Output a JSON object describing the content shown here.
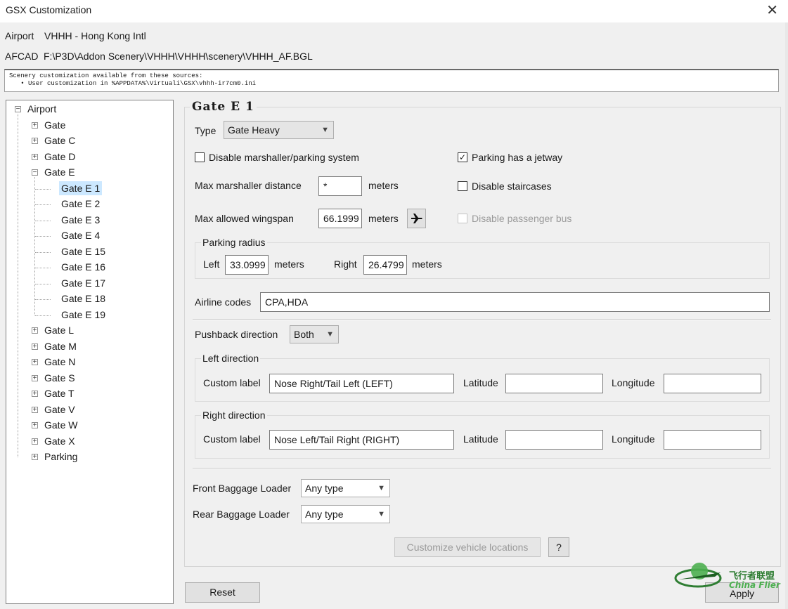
{
  "window": {
    "title": "GSX Customization",
    "close_glyph": "✕"
  },
  "header": {
    "airport_label": "Airport",
    "airport_value": "VHHH - Hong Kong Intl",
    "afcad_label": "AFCAD",
    "afcad_value": "F:\\P3D\\Addon Scenery\\VHHH\\VHHH\\scenery\\VHHH_AF.BGL"
  },
  "sources": {
    "line1": "Scenery customization available from these sources:",
    "line2": "   • User customization in %APPDATA%\\Virtuali\\GSX\\vhhh-ir7cm0.ini"
  },
  "tree": {
    "root": "Airport",
    "groups_before": [
      "Gate",
      "Gate C",
      "Gate D"
    ],
    "expanded_group": "Gate E",
    "children": [
      "Gate E 1",
      "Gate E 2",
      "Gate E 3",
      "Gate E 4",
      "Gate E 15",
      "Gate E 16",
      "Gate E 17",
      "Gate E 18",
      "Gate E 19"
    ],
    "groups_after": [
      "Gate L",
      "Gate M",
      "Gate N",
      "Gate S",
      "Gate T",
      "Gate V",
      "Gate W",
      "Gate X",
      "Parking"
    ],
    "selected": "Gate E 1"
  },
  "detail": {
    "title": "Gate E 1",
    "type_label": "Type",
    "type_value": "Gate Heavy",
    "disable_marshaller_label": "Disable marshaller/parking system",
    "disable_marshaller_checked": false,
    "jetway_label": "Parking has a jetway",
    "jetway_checked": true,
    "max_marshaller_label": "Max marshaller distance",
    "max_marshaller_value": "*",
    "meters": "meters",
    "disable_staircases_label": "Disable staircases",
    "disable_staircases_checked": false,
    "max_wingspan_label": "Max allowed wingspan",
    "max_wingspan_value": "66.1999",
    "plane_icon": "airplane-icon",
    "disable_bus_label": "Disable passenger bus",
    "disable_bus_checked": false,
    "parking_radius": {
      "title": "Parking radius",
      "left_label": "Left",
      "left_value": "33.0999",
      "right_label": "Right",
      "right_value": "26.4799"
    },
    "airline_codes_label": "Airline codes",
    "airline_codes_value": "CPA,HDA",
    "pushback_label": "Pushback direction",
    "pushback_value": "Both",
    "left_direction": {
      "title": "Left direction",
      "custom_label": "Custom label",
      "custom_value": "Nose Right/Tail Left (LEFT)",
      "latitude_label": "Latitude",
      "latitude_value": "",
      "longitude_label": "Longitude",
      "longitude_value": ""
    },
    "right_direction": {
      "title": "Right direction",
      "custom_label": "Custom label",
      "custom_value": "Nose Left/Tail Right (RIGHT)",
      "latitude_label": "Latitude",
      "latitude_value": "",
      "longitude_label": "Longitude",
      "longitude_value": ""
    },
    "front_loader_label": "Front Baggage Loader",
    "front_loader_value": "Any type",
    "rear_loader_label": "Rear Baggage Loader",
    "rear_loader_value": "Any type",
    "customize_vehicle_label": "Customize vehicle locations",
    "help_label": "?"
  },
  "footer": {
    "reset_label": "Reset",
    "apply_label": "Apply"
  },
  "watermark": {
    "cn": "飞行者联盟",
    "en": "China Flier"
  },
  "colors": {
    "accent_selected": "#cce8ff",
    "disabled_text": "#9a9a9a",
    "watermark_green": "#2e7d32"
  }
}
